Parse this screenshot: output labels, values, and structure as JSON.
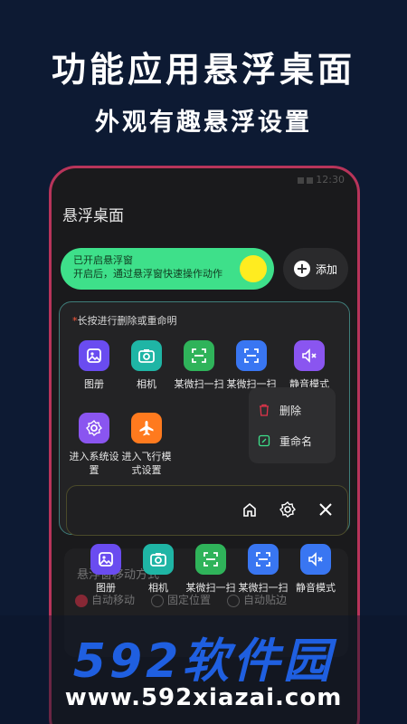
{
  "promo": {
    "headline": "功能应用悬浮桌面",
    "subline": "外观有趣悬浮设置"
  },
  "status": {
    "time": "12:30"
  },
  "app": {
    "title": "悬浮桌面",
    "toggle": {
      "line1": "已开启悬浮窗",
      "line2": "开启后，通过悬浮窗快速操作动作",
      "state": "on"
    },
    "add_label": "添加",
    "hint_star": "*",
    "hint_text": "长按进行删除或重命明",
    "grid": [
      {
        "label": "图册",
        "icon": "photo-album-icon",
        "color": "#6a4cf0"
      },
      {
        "label": "相机",
        "icon": "camera-icon",
        "color": "#1fb5a5"
      },
      {
        "label": "某微扫一扫",
        "icon": "scan-icon",
        "color": "#2fb35a"
      },
      {
        "label": "某微扫一扫",
        "icon": "scan-icon",
        "color": "#3976f2"
      },
      {
        "label": "静音模式",
        "icon": "mute-icon",
        "color": "#8a55f0"
      },
      {
        "label": "进入系统设置",
        "icon": "gear-icon",
        "color": "#8a55f0"
      },
      {
        "label": "进入飞行模式设置",
        "icon": "airplane-icon",
        "color": "#ff7a1e"
      }
    ],
    "context_menu": {
      "delete": "删除",
      "rename": "重命名"
    },
    "settings": {
      "title": "悬浮窗移动方式",
      "options": [
        "自动移动",
        "固定位置",
        "自动贴边"
      ]
    },
    "float_apps": [
      {
        "label": "图册",
        "icon": "photo-album-icon"
      },
      {
        "label": "相机",
        "icon": "camera-icon"
      },
      {
        "label": "某微扫一扫",
        "icon": "scan-icon"
      },
      {
        "label": "某微扫一扫",
        "icon": "scan-icon"
      },
      {
        "label": "静音模式",
        "icon": "mute-icon"
      }
    ]
  },
  "watermark": {
    "brand": "592软件园",
    "url": "www.592xiazai.com"
  }
}
